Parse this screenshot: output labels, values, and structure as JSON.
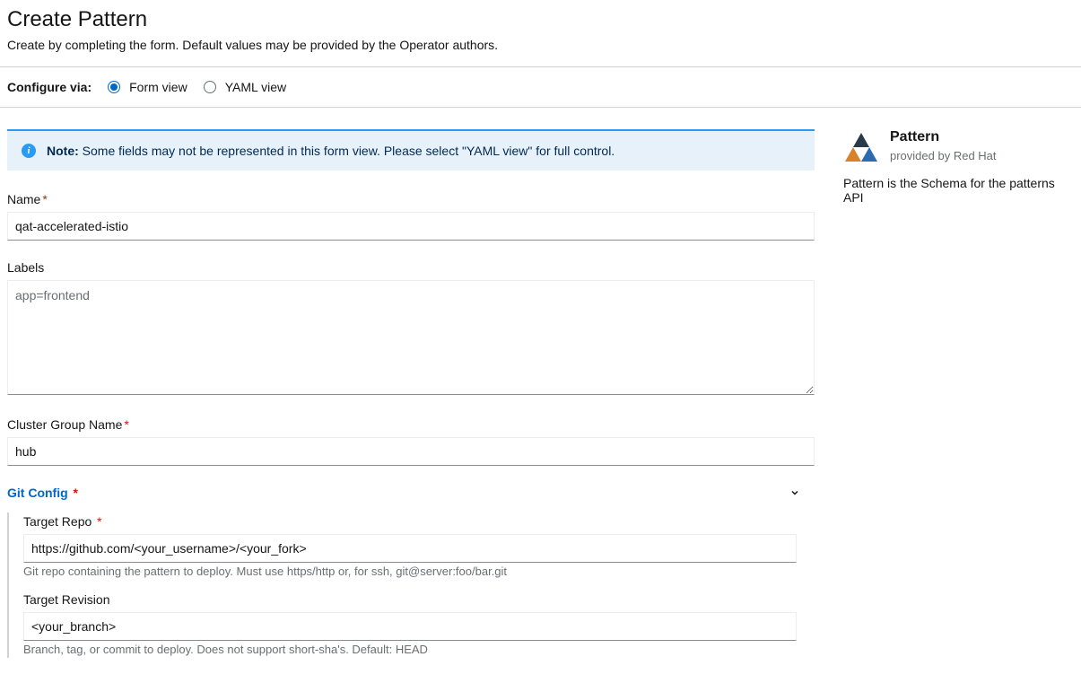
{
  "header": {
    "title": "Create Pattern",
    "subtitle": "Create by completing the form. Default values may be provided by the Operator authors."
  },
  "configure": {
    "label": "Configure via:",
    "options": {
      "form": "Form view",
      "yaml": "YAML view"
    },
    "selected": "form"
  },
  "alert": {
    "prefix": "Note:",
    "text": " Some fields may not be represented in this form view. Please select \"YAML view\" for full control."
  },
  "form": {
    "name": {
      "label": "Name",
      "required": true,
      "value": "qat-accelerated-istio"
    },
    "labels": {
      "label": "Labels",
      "placeholder": "app=frontend",
      "value": ""
    },
    "clusterGroupName": {
      "label": "Cluster Group Name",
      "required": true,
      "value": "hub"
    },
    "gitConfig": {
      "heading": "Git Config",
      "required": true,
      "targetRepo": {
        "label": "Target Repo",
        "required": true,
        "value": "https://github.com/<your_username>/<your_fork>",
        "helper": "Git repo containing the pattern to deploy. Must use https/http or, for ssh, git@server:foo/bar.git"
      },
      "targetRevision": {
        "label": "Target Revision",
        "value": "<your_branch>",
        "helper": "Branch, tag, or commit to deploy. Does not support short-sha's. Default: HEAD"
      }
    }
  },
  "sidebar": {
    "title": "Pattern",
    "provided": "provided by Red Hat",
    "description": "Pattern is the Schema for the patterns API"
  }
}
